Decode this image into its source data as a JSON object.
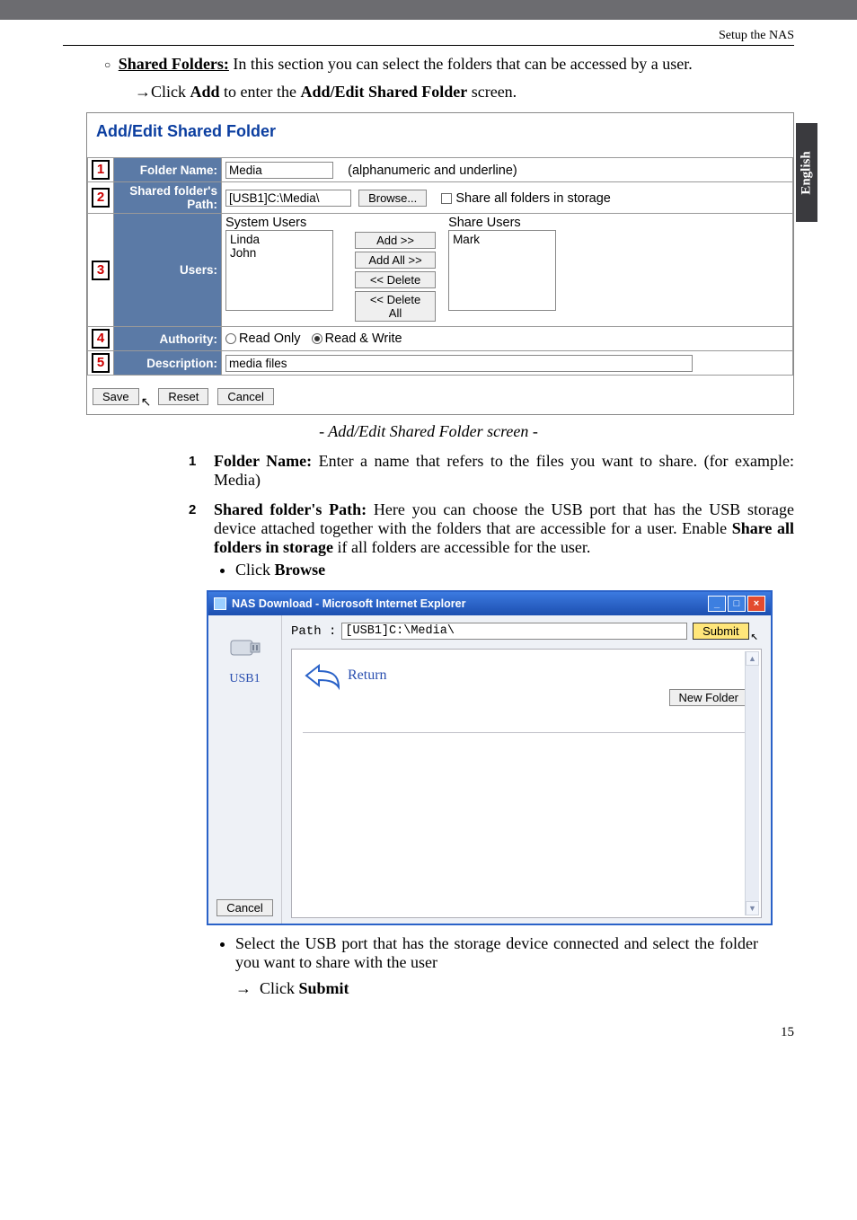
{
  "header": {
    "setup": "Setup the NAS"
  },
  "sideTab": "English",
  "intro": {
    "title": "Shared Folders:",
    "rest": " In this section you can select the folders that can be accessed by a user.",
    "sub_pre": "Click ",
    "sub_b1": "Add",
    "sub_mid": " to enter the ",
    "sub_b2": "Add/Edit Shared Folder",
    "sub_post": " screen."
  },
  "panel": {
    "title": "Add/Edit Shared Folder",
    "rows": {
      "r1": {
        "num": "1",
        "label": "Folder Name:",
        "value": "Media",
        "hint": "(alphanumeric and underline)"
      },
      "r2": {
        "num": "2",
        "label": "Shared folder's Path:",
        "value": "[USB1]C:\\Media\\",
        "browse": "Browse...",
        "shareAll": "Share all folders in storage"
      },
      "r3": {
        "num": "3",
        "label": "Users:",
        "sysHead": "System Users",
        "sys1": "Linda",
        "sys2": "John",
        "btnAdd": "Add >>",
        "btnAddAll": "Add All >>",
        "btnDel": "<< Delete",
        "btnDelAll": "<< Delete All",
        "shareHead": "Share Users",
        "share1": "Mark"
      },
      "r4": {
        "num": "4",
        "label": "Authority:",
        "ro": "Read Only",
        "rw": "Read & Write"
      },
      "r5": {
        "num": "5",
        "label": "Description:",
        "value": "media files"
      }
    },
    "save": "Save",
    "reset": "Reset",
    "cancel": "Cancel"
  },
  "caption": "- Add/Edit Shared Folder screen -",
  "list": {
    "i1": {
      "num": "1",
      "head": "Folder Name:",
      "body": " Enter a name that refers to the files you want to share. (for example: Media)"
    },
    "i2": {
      "num": "2",
      "head": "Shared folder's Path:",
      "body": " Here you can choose the USB port that has the USB storage device attached together with the folders that are accessible for a user. Enable ",
      "bold": "Share all folders in storage",
      "body2": " if all folders are accessible for the user.",
      "bul1a": "Click ",
      "bul1b": "Browse"
    }
  },
  "ie": {
    "title": "NAS Download - Microsoft Internet Explorer",
    "usb": "USB1",
    "cancel": "Cancel",
    "pathLabel": "Path :",
    "pathValue": "[USB1]C:\\Media\\",
    "submit": "Submit",
    "return": "Return",
    "newFolder": "New Folder"
  },
  "after": {
    "b1": "Select the USB port that has the storage device connected and select the folder you want to share with the user",
    "b2a": "Click ",
    "b2b": "Submit"
  },
  "pageNum": "15"
}
